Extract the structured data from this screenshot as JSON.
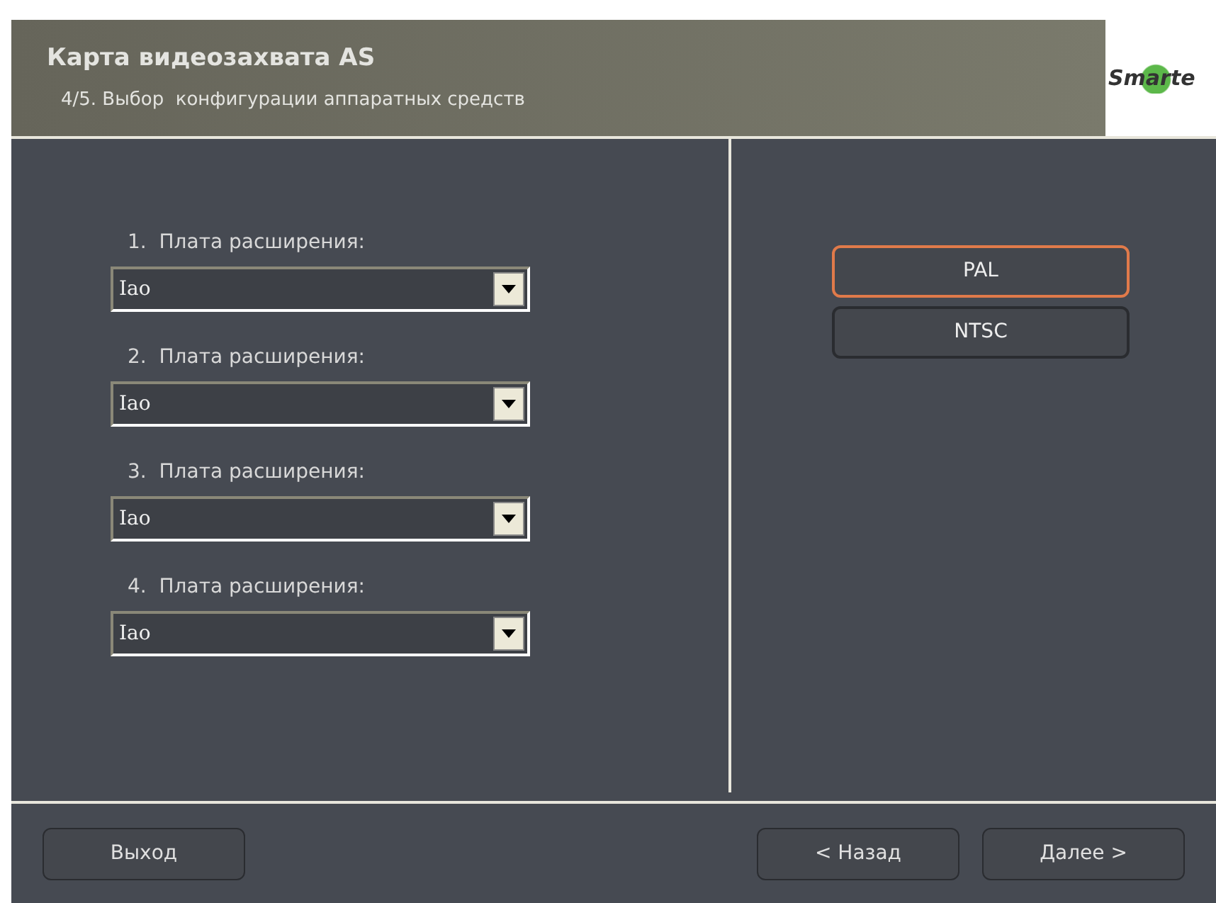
{
  "header": {
    "title": "Карта видеозахвата AS",
    "subtitle": "4/5. Выбор  конфигурации аппаратных средств",
    "logo": "Smarte"
  },
  "boards": [
    {
      "number": "1.",
      "label": "Плата расширения:",
      "value": "Iao"
    },
    {
      "number": "2.",
      "label": "Плата расширения:",
      "value": "Iao"
    },
    {
      "number": "3.",
      "label": "Плата расширения:",
      "value": "Iao"
    },
    {
      "number": "4.",
      "label": "Плата расширения:",
      "value": "Iao"
    }
  ],
  "standards": [
    {
      "label": "PAL",
      "selected": true
    },
    {
      "label": "NTSC",
      "selected": false
    }
  ],
  "footer": {
    "exit": "Выход",
    "back": "< Назад",
    "next": "Далее >"
  }
}
